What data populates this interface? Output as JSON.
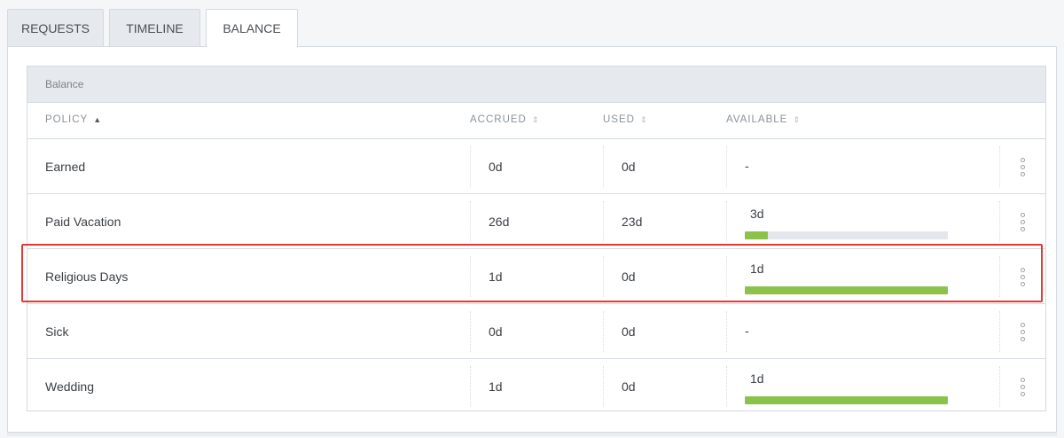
{
  "tabs": [
    {
      "label": "REQUESTS",
      "active": false
    },
    {
      "label": "TIMELINE",
      "active": false
    },
    {
      "label": "BALANCE",
      "active": true
    }
  ],
  "card": {
    "title": "Balance",
    "columns": {
      "policy": "POLICY",
      "accrued": "ACCRUED",
      "used": "USED",
      "available": "AVAILABLE"
    },
    "sort_active_column": "policy"
  },
  "rows": [
    {
      "policy": "Earned",
      "accrued": "0d",
      "used": "0d",
      "available": "-",
      "available_fraction": null
    },
    {
      "policy": "Paid Vacation",
      "accrued": "26d",
      "used": "23d",
      "available": "3d",
      "available_fraction": 0.115
    },
    {
      "policy": "Religious Days",
      "accrued": "1d",
      "used": "0d",
      "available": "1d",
      "available_fraction": 1.0
    },
    {
      "policy": "Sick",
      "accrued": "0d",
      "used": "0d",
      "available": "-",
      "available_fraction": null
    },
    {
      "policy": "Wedding",
      "accrued": "1d",
      "used": "0d",
      "available": "1d",
      "available_fraction": 1.0
    }
  ],
  "highlighted_row": "Religious Days",
  "colors": {
    "bar_fill": "#8bc34a",
    "bar_track": "#e3e7eb",
    "highlight": "#e53935"
  }
}
